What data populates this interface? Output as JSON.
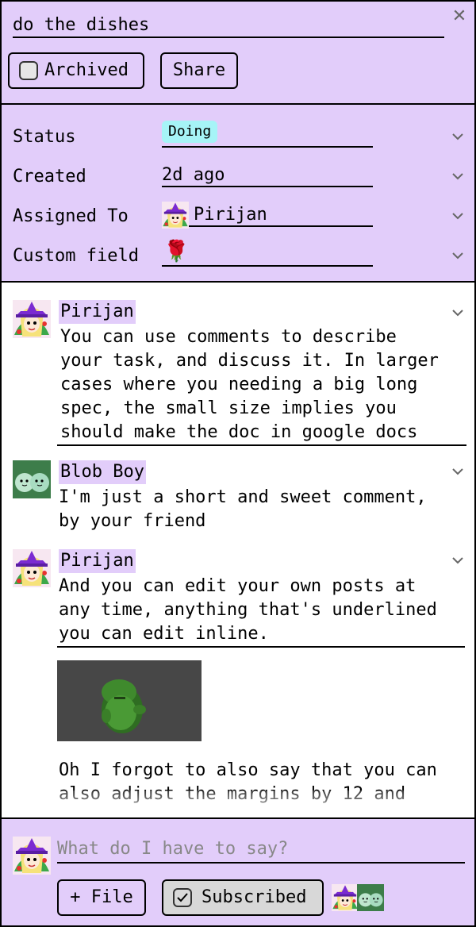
{
  "task": {
    "title": "do the dishes",
    "close_icon": "close-icon",
    "archived_label": "Archived",
    "archived_checked": false,
    "share_label": "Share"
  },
  "properties": {
    "status": {
      "label": "Status",
      "value": "Doing",
      "badge_color": "#a6f4f7"
    },
    "created": {
      "label": "Created",
      "value": "2d ago"
    },
    "assigned": {
      "label": "Assigned To",
      "value": "Pirijan",
      "avatar": "witch-avatar-icon"
    },
    "custom": {
      "label": "Custom field",
      "value": "🌹"
    }
  },
  "comments": [
    {
      "author": "Pirijan",
      "avatar": "witch-avatar-icon",
      "lines": [
        "You can use comments to describe",
        "your task, and discuss it. In larger",
        "cases where you needing a big long",
        "spec, the small size implies you",
        "should make the doc in google docs"
      ]
    },
    {
      "author": "Blob Boy",
      "avatar": "blob-avatar-icon",
      "lines": [
        "I'm just a short and sweet comment,",
        "by your friend"
      ]
    },
    {
      "author": "Pirijan",
      "avatar": "witch-avatar-icon",
      "lines": [
        "And you can edit your own posts at",
        "any time, anything that's underlined",
        "you can edit inline."
      ],
      "image": "green-frog-figure",
      "more_lines": [
        "Oh I forgot to also say that you can",
        "also adjust the margins by 12 and"
      ]
    }
  ],
  "composer": {
    "placeholder": "What do I have to say?",
    "file_label": "+ File",
    "subscribed_label": "Subscribed",
    "subscribed_checked": true
  },
  "colors": {
    "accent": "#e2cdfa",
    "badge": "#a6f4f7",
    "subscribed_button": "#d8d8d8"
  }
}
